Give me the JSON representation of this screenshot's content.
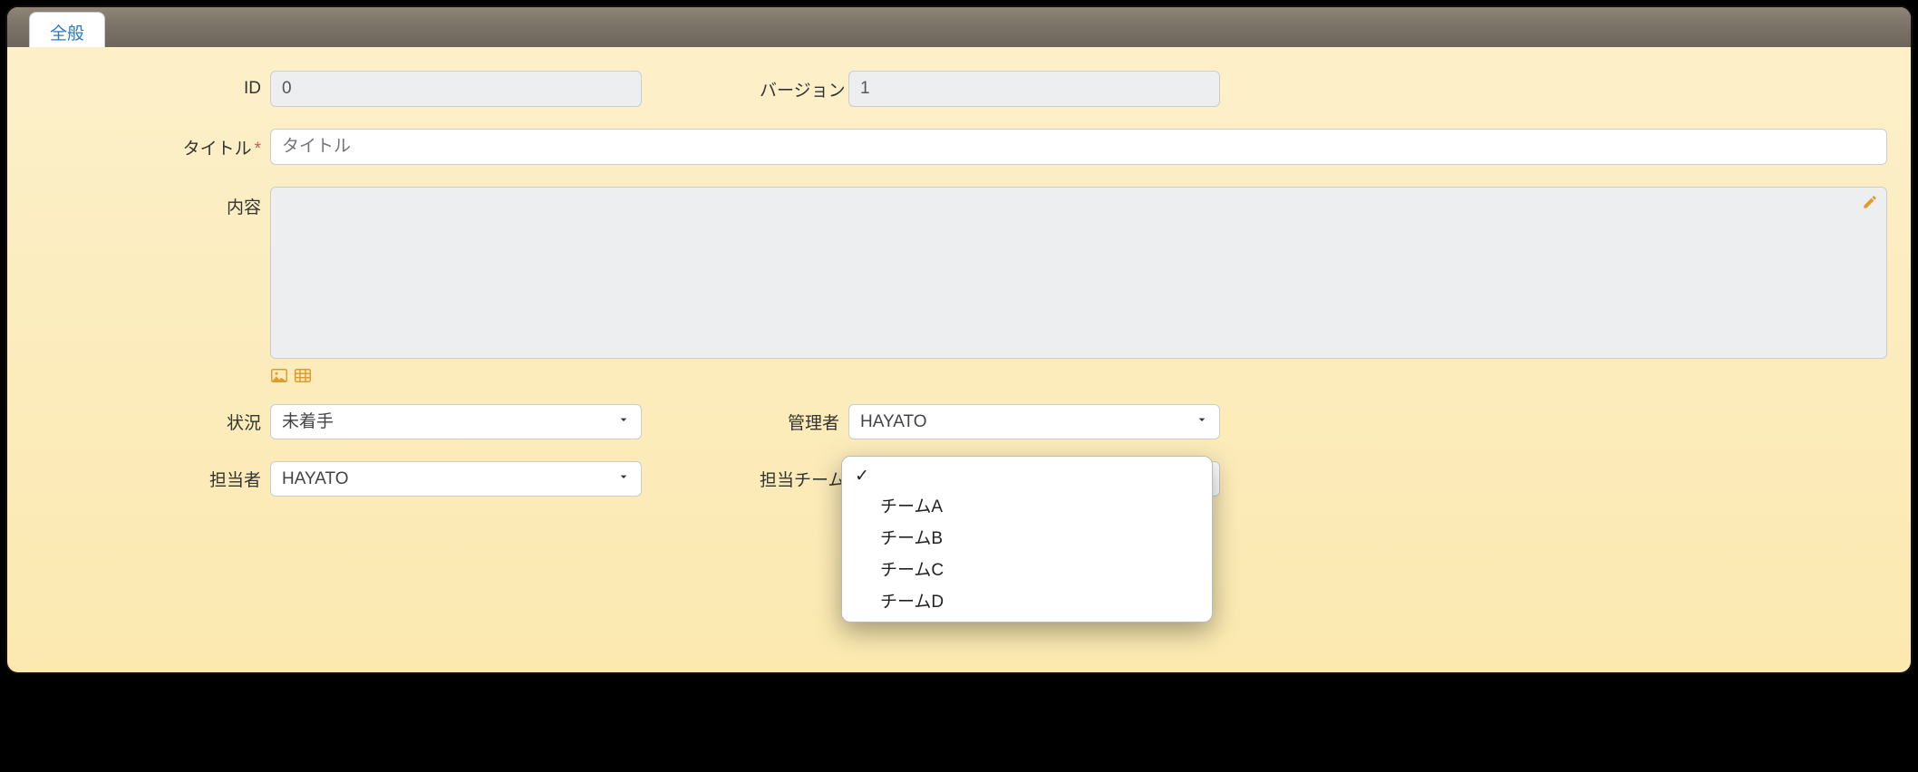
{
  "tab": {
    "general": "全般"
  },
  "labels": {
    "id": "ID",
    "version": "バージョン",
    "title": "タイトル",
    "content": "内容",
    "status": "状況",
    "manager": "管理者",
    "assignee": "担当者",
    "team": "担当チーム"
  },
  "values": {
    "id": "0",
    "version": "1",
    "title": "",
    "title_placeholder": "タイトル",
    "content": "",
    "status": "未着手",
    "manager": "HAYATO",
    "assignee": "HAYATO",
    "team": ""
  },
  "team_options": [
    {
      "label": "",
      "checked": true
    },
    {
      "label": "チームA",
      "checked": false
    },
    {
      "label": "チームB",
      "checked": false
    },
    {
      "label": "チームC",
      "checked": false
    },
    {
      "label": "チームD",
      "checked": false
    }
  ]
}
